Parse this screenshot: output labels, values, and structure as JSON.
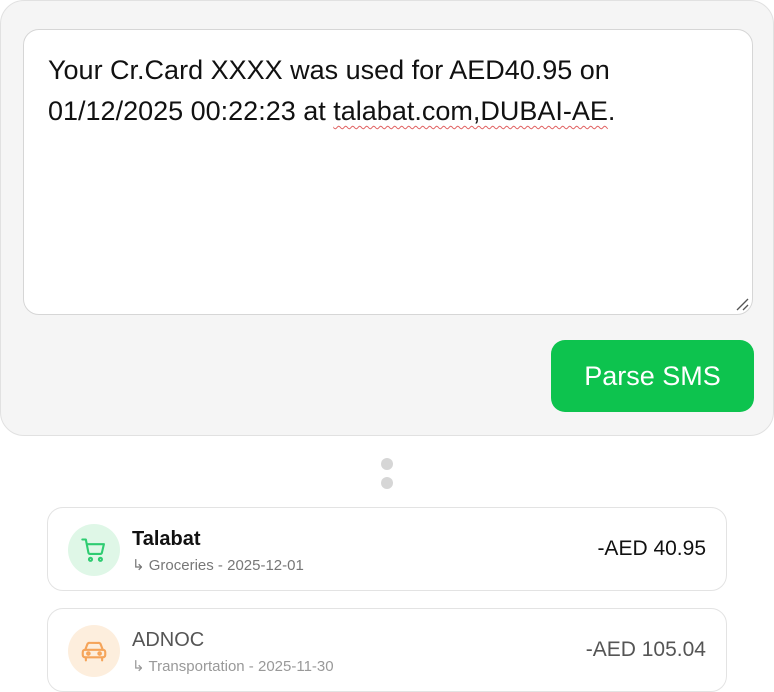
{
  "sms": {
    "line1": "Your Cr.Card XXXX was used for AED40.95 on",
    "line2_prefix": "01/12/2025 00:22:23 at ",
    "line2_merchant": "talabat.com,DUBAI-AE",
    "line2_suffix": "."
  },
  "parse_button": {
    "label": "Parse SMS",
    "color": "#0dc34e"
  },
  "transactions": [
    {
      "merchant": "Talabat",
      "arrow": "↳",
      "detail": "Groceries - 2025-12-01",
      "amount": "-AED 40.95",
      "icon": "shopping-cart-icon",
      "icon_color": "#2ecc71",
      "icon_bg": "#dff7e7"
    },
    {
      "merchant": "ADNOC",
      "arrow": "↳",
      "detail": "Transportation - 2025-11-30",
      "amount": "-AED 105.04",
      "icon": "car-icon",
      "icon_color": "#f5a45a",
      "icon_bg": "#fdeedd"
    }
  ]
}
